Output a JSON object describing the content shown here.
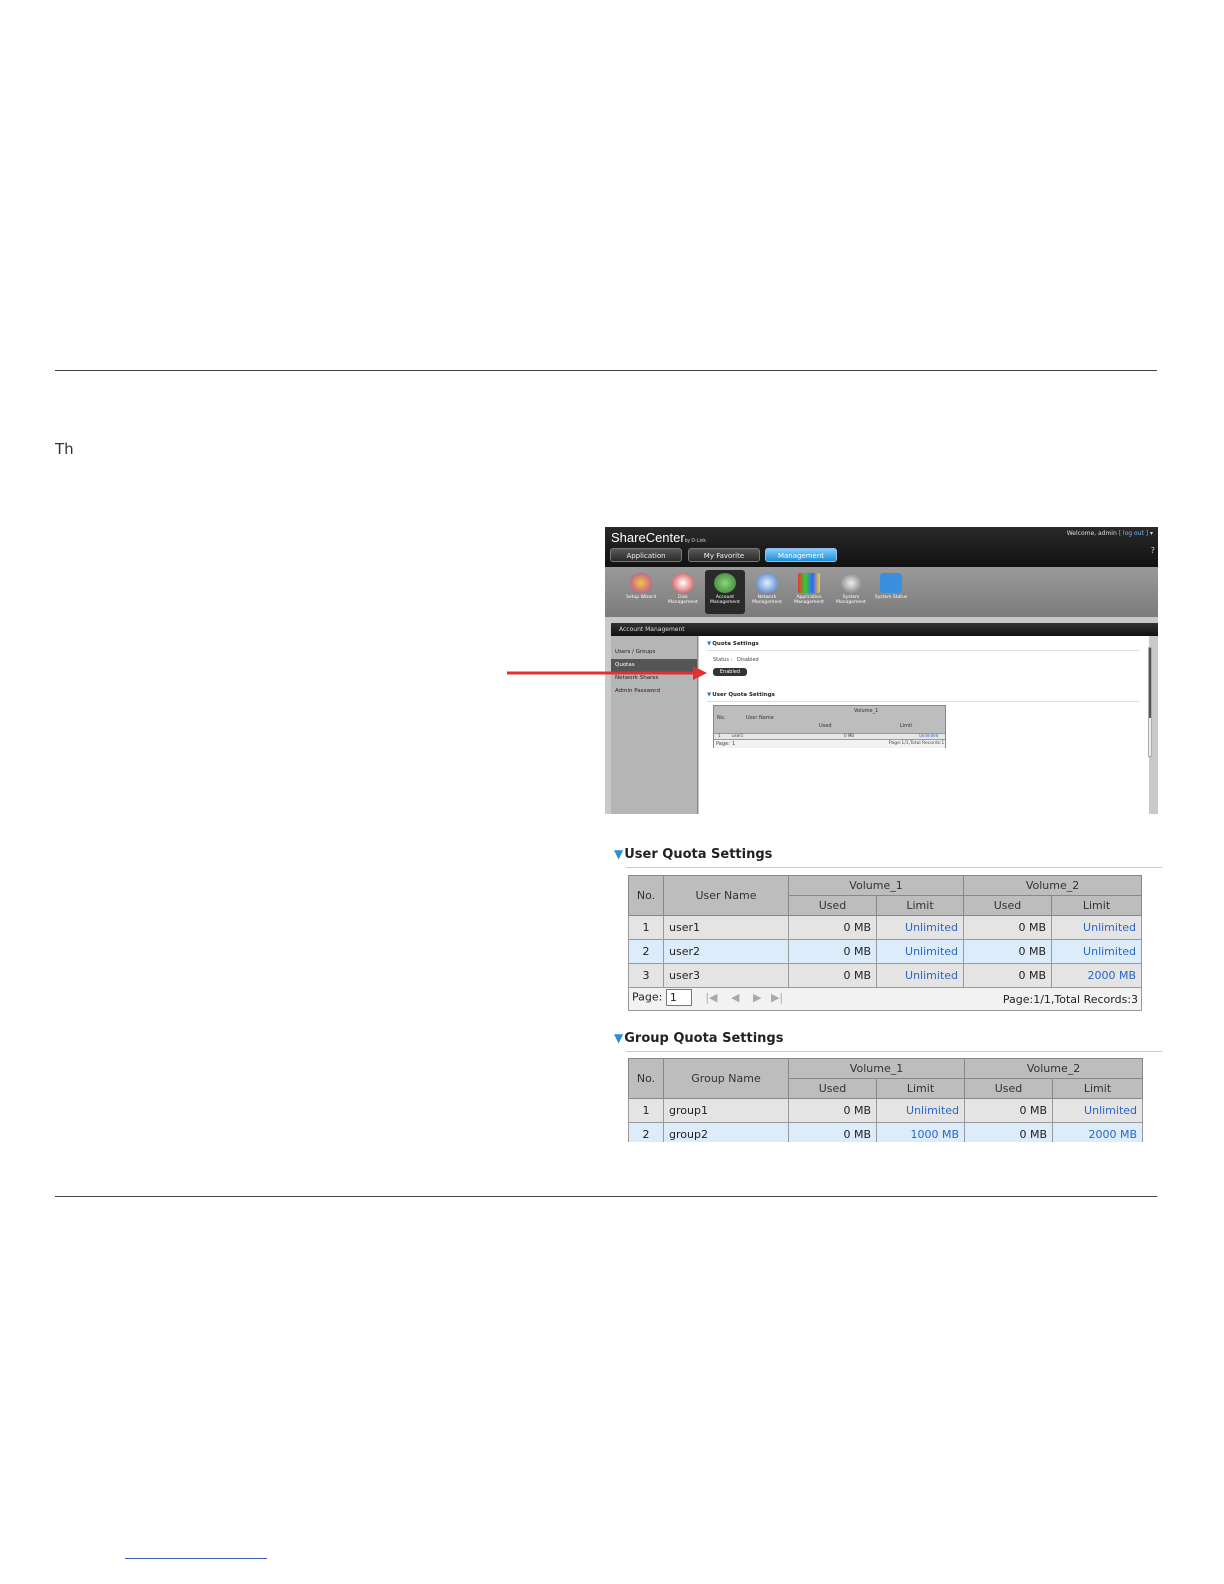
{
  "page": {
    "intro_text": "Th"
  },
  "sharecenter": {
    "logo": "ShareCenter",
    "logo_sub": "by D-Link",
    "welcome": "Welcome, admin",
    "logout": "[ log out ]",
    "help": "?",
    "tabs": [
      "Application",
      "My Favorite",
      "Management"
    ],
    "icons": [
      "Setup Wizard",
      "Disk Management",
      "Account Management",
      "Network Management",
      "Application Management",
      "System Management",
      "System Status"
    ],
    "panel_title": "Account Management",
    "sidebar": [
      "Users / Groups",
      "Quotas",
      "Network Shares",
      "Admin Password"
    ],
    "quota_section": "Quota Settings",
    "status_label": "Status :",
    "status_value": "Disabled",
    "enable_button": "Enabled",
    "user_quota_section": "User Quota Settings",
    "mini_table": {
      "col_no": "No.",
      "col_user": "User Name",
      "col_volume": "Volume_1",
      "col_used": "Used",
      "col_limit": "Limit",
      "row_no": "1",
      "row_user": "user1",
      "row_used": "0 MB",
      "row_limit": "Unlimited",
      "page_label": "Page:",
      "page_value": "1",
      "page_info": "Page:1/1,Total Records:1"
    }
  },
  "user_quota": {
    "title": "User Quota Settings",
    "col_no": "No.",
    "col_name": "User Name",
    "volumes": [
      "Volume_1",
      "Volume_2"
    ],
    "col_used": "Used",
    "col_limit": "Limit",
    "rows": [
      {
        "no": "1",
        "name": "user1",
        "v1_used": "0 MB",
        "v1_limit": "Unlimited",
        "v2_used": "0 MB",
        "v2_limit": "Unlimited"
      },
      {
        "no": "2",
        "name": "user2",
        "v1_used": "0 MB",
        "v1_limit": "Unlimited",
        "v2_used": "0 MB",
        "v2_limit": "Unlimited"
      },
      {
        "no": "3",
        "name": "user3",
        "v1_used": "0 MB",
        "v1_limit": "Unlimited",
        "v2_used": "0 MB",
        "v2_limit": "2000 MB"
      }
    ],
    "page_label": "Page:",
    "page_value": "1",
    "page_info": "Page:1/1,Total Records:3"
  },
  "group_quota": {
    "title": "Group Quota Settings",
    "col_no": "No.",
    "col_name": "Group Name",
    "volumes": [
      "Volume_1",
      "Volume_2"
    ],
    "col_used": "Used",
    "col_limit": "Limit",
    "rows": [
      {
        "no": "1",
        "name": "group1",
        "v1_used": "0 MB",
        "v1_limit": "Unlimited",
        "v2_used": "0 MB",
        "v2_limit": "Unlimited"
      },
      {
        "no": "2",
        "name": "group2",
        "v1_used": "0 MB",
        "v1_limit": "1000 MB",
        "v2_used": "0 MB",
        "v2_limit": "2000 MB"
      }
    ]
  },
  "colors": {
    "accent_blue": "#2a8fd6",
    "link_blue": "#2a66c8",
    "arrow_red": "#e03030",
    "tab_active": "#1e8fd6"
  },
  "icons": {
    "collapse": "triangle-down-icon",
    "pointer": "red-arrow-icon",
    "first": "first-page-icon",
    "prev": "prev-page-icon",
    "next": "next-page-icon",
    "last": "last-page-icon"
  }
}
